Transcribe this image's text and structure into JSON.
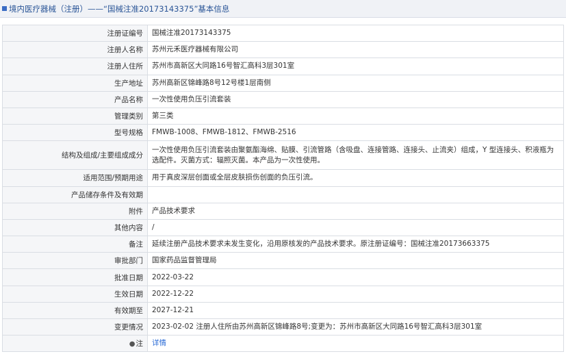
{
  "header": {
    "title": "境内医疗器械（注册）——“国械注准20173143375”基本信息"
  },
  "rows": [
    {
      "label": "注册证编号",
      "value": "国械注准20173143375"
    },
    {
      "label": "注册人名称",
      "value": "苏州元禾医疗器械有限公司"
    },
    {
      "label": "注册人住所",
      "value": "苏州市高新区大同路16号智汇高科3层301室"
    },
    {
      "label": "生产地址",
      "value": "苏州高新区锦峰路8号12号楼1层南侧"
    },
    {
      "label": "产品名称",
      "value": "一次性使用负压引流套装"
    },
    {
      "label": "管理类别",
      "value": "第三类"
    },
    {
      "label": "型号规格",
      "value": "FMWB-1008、FMWB-1812、FMWB-2516"
    },
    {
      "label": "结构及组成/主要组成成分",
      "value": "一次性使用负压引流套装由聚氨酯海绵、贴膜、引流管路（含吸盘、连接管路、连接头、止流夹）组成，Y 型连接头、积液瓶为选配件。灭菌方式：辐照灭菌。本产品为一次性使用。"
    },
    {
      "label": "适用范围/预期用途",
      "value": "用于真皮深层创面或全层皮肤损伤创面的负压引流。"
    },
    {
      "label": "产品储存条件及有效期",
      "value": ""
    },
    {
      "label": "附件",
      "value": "产品技术要求"
    },
    {
      "label": "其他内容",
      "value": "/"
    },
    {
      "label": "备注",
      "value": "延续注册产品技术要求未发生变化，沿用原核发的产品技术要求。原注册证编号：国械注准20173663375"
    },
    {
      "label": "审批部门",
      "value": "国家药品监督管理局"
    },
    {
      "label": "批准日期",
      "value": "2022-03-22"
    },
    {
      "label": "生效日期",
      "value": "2022-12-22"
    },
    {
      "label": "有效期至",
      "value": "2027-12-21"
    },
    {
      "label": "变更情况",
      "value": "2023-02-02 注册人住所由苏州高新区锦峰路8号;变更为：苏州市高新区大同路16号智汇高科3层301室"
    },
    {
      "label": "注",
      "value": "详情"
    }
  ]
}
